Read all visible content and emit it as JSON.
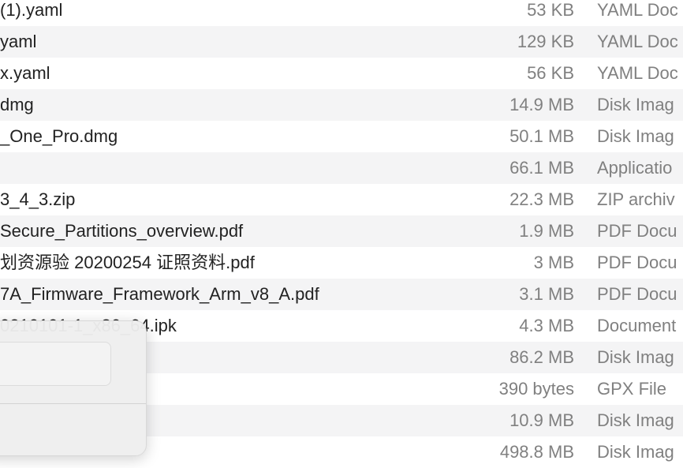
{
  "files": [
    {
      "name": "(1).yaml",
      "size": "53 KB",
      "kind": "YAML Doc"
    },
    {
      "name": "yaml",
      "size": "129 KB",
      "kind": "YAML Doc"
    },
    {
      "name": "x.yaml",
      "size": "56 KB",
      "kind": "YAML Doc"
    },
    {
      "name": "dmg",
      "size": "14.9 MB",
      "kind": "Disk Imag"
    },
    {
      "name": "_One_Pro.dmg",
      "size": "50.1 MB",
      "kind": "Disk Imag"
    },
    {
      "name": "",
      "size": "66.1 MB",
      "kind": "Applicatio"
    },
    {
      "name": "3_4_3.zip",
      "size": "22.3 MB",
      "kind": "ZIP archiv"
    },
    {
      "name": "Secure_Partitions_overview.pdf",
      "size": "1.9 MB",
      "kind": "PDF Docu"
    },
    {
      "name": "划资源验 20200254 证照资料.pdf",
      "size": "3 MB",
      "kind": "PDF Docu"
    },
    {
      "name": "7A_Firmware_Framework_Arm_v8_A.pdf",
      "size": "3.1 MB",
      "kind": "PDF Docu"
    },
    {
      "name": "0210101-1_x86_64.ipk",
      "size": "4.3 MB",
      "kind": "Document"
    },
    {
      "name": "",
      "size": "86.2 MB",
      "kind": "Disk Imag"
    },
    {
      "name": "",
      "size": "390 bytes",
      "kind": "GPX File"
    },
    {
      "name": "",
      "size": "10.9 MB",
      "kind": "Disk Imag"
    },
    {
      "name": "",
      "size": "498.8 MB",
      "kind": "Disk Imag"
    }
  ]
}
